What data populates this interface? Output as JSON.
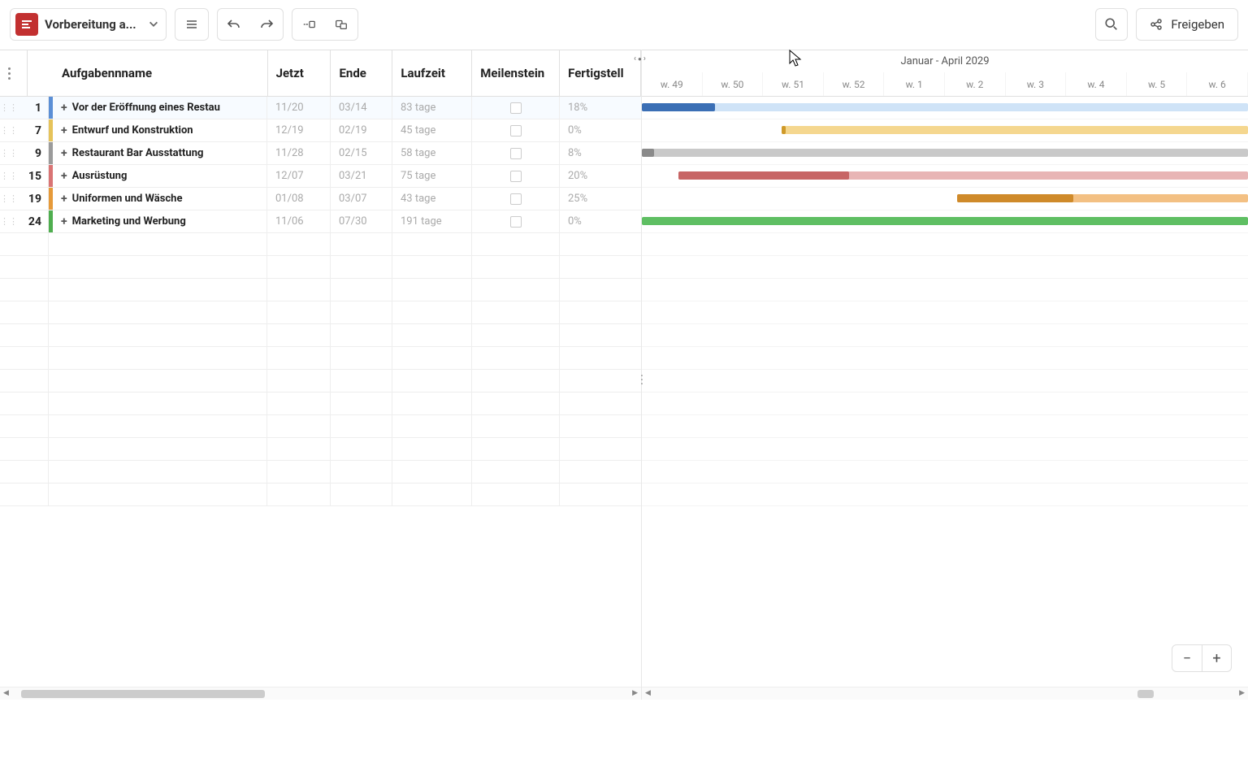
{
  "toolbar": {
    "project_name": "Vorbereitung a...",
    "share_label": "Freigeben"
  },
  "grid": {
    "headers": {
      "task_name": "Aufgabennname",
      "now": "Jetzt",
      "end": "Ende",
      "duration": "Laufzeit",
      "milestone": "Meilenstein",
      "completion": "Fertigstell"
    },
    "rows": [
      {
        "id": "1",
        "color": "#5b8fd6",
        "name": "Vor der Eröffnung eines Restau",
        "now": "11/20",
        "end": "03/14",
        "dur": "83 tage",
        "mile": false,
        "comp": "18%"
      },
      {
        "id": "7",
        "color": "#e6c35a",
        "name": "Entwurf und Konstruktion",
        "now": "12/19",
        "end": "02/19",
        "dur": "45 tage",
        "mile": false,
        "comp": "0%"
      },
      {
        "id": "9",
        "color": "#9b9b9b",
        "name": "Restaurant Bar Ausstattung",
        "now": "11/28",
        "end": "02/15",
        "dur": "58 tage",
        "mile": false,
        "comp": "8%"
      },
      {
        "id": "15",
        "color": "#d97474",
        "name": "Ausrüstung",
        "now": "12/07",
        "end": "03/21",
        "dur": "75 tage",
        "mile": false,
        "comp": "20%"
      },
      {
        "id": "19",
        "color": "#e69a3a",
        "name": "Uniformen und Wäsche",
        "now": "01/08",
        "end": "03/07",
        "dur": "43 tage",
        "mile": false,
        "comp": "25%"
      },
      {
        "id": "24",
        "color": "#4fae4f",
        "name": "Marketing und Werbung",
        "now": "11/06",
        "end": "07/30",
        "dur": "191 tage",
        "mile": false,
        "comp": "0%"
      }
    ]
  },
  "timeline": {
    "title": "Januar - April 2029",
    "weeks": [
      "w. 49",
      "w. 50",
      "w. 51",
      "w. 52",
      "w. 1",
      "w. 2",
      "w. 3",
      "w. 4",
      "w. 5",
      "w. 6"
    ]
  },
  "chart_data": {
    "type": "gantt",
    "time_axis_weeks": [
      "w. 49",
      "w. 50",
      "w. 51",
      "w. 52",
      "w. 1",
      "w. 2",
      "w. 3",
      "w. 4",
      "w. 5",
      "w. 6"
    ],
    "bars": [
      {
        "task_id": "1",
        "start_week": "w. 49",
        "end_week": "beyond w. 6",
        "visible_left_pct": 0,
        "visible_right_pct": 100,
        "progress_pct": 18,
        "color_bg": "#cfe3f7",
        "color_progress": "#3b6fb5"
      },
      {
        "task_id": "7",
        "start_week": "w. 51",
        "end_week": "beyond w. 6",
        "visible_left_pct": 23,
        "visible_right_pct": 100,
        "progress_pct": 0,
        "color_bg": "#f5d78f",
        "color_progress": "#cf9a2a"
      },
      {
        "task_id": "9",
        "start_week": "w. 49",
        "end_week": "beyond w. 6",
        "visible_left_pct": 0,
        "visible_right_pct": 100,
        "progress_pct": 8,
        "color_bg": "#c9c9c9",
        "color_progress": "#8a8a8a"
      },
      {
        "task_id": "15",
        "start_week": "mid w. 49",
        "end_week": "beyond w. 6",
        "visible_left_pct": 6,
        "visible_right_pct": 100,
        "progress_pct": 20,
        "color_bg": "#e8b5b5",
        "color_progress": "#c76565"
      },
      {
        "task_id": "19",
        "start_week": "w. 1",
        "end_week": "beyond w. 6",
        "visible_left_pct": 52,
        "visible_right_pct": 100,
        "progress_pct": 25,
        "color_bg": "#f3c083",
        "color_progress": "#cf8a2a"
      },
      {
        "task_id": "24",
        "start_week": "w. 49",
        "end_week": "beyond w. 6",
        "visible_left_pct": 0,
        "visible_right_pct": 100,
        "progress_pct": 0,
        "color_bg": "#5fbf63",
        "color_progress": "#3a8d3e"
      }
    ]
  }
}
